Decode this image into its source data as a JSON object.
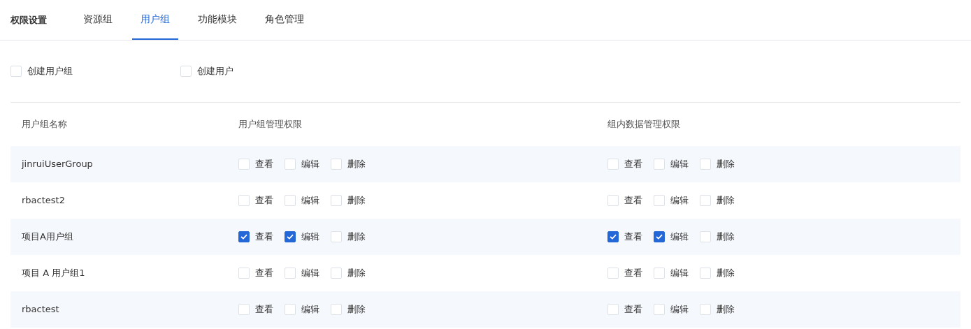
{
  "header": {
    "title": "权限设置",
    "tabs": [
      {
        "label": "资源组",
        "selected": false
      },
      {
        "label": "用户组",
        "selected": true
      },
      {
        "label": "功能模块",
        "selected": false
      },
      {
        "label": "角色管理",
        "selected": false
      }
    ]
  },
  "options": [
    {
      "label": "创建用户组",
      "checked": false
    },
    {
      "label": "创建用户",
      "checked": false
    }
  ],
  "table": {
    "columns": [
      "用户组名称",
      "用户组管理权限",
      "组内数据管理权限"
    ],
    "rows": [
      {
        "name": "jinruiUserGroup",
        "groups": [
          [
            {
              "label": "查看",
              "checked": false
            },
            {
              "label": "编辑",
              "checked": false
            },
            {
              "label": "删除",
              "checked": false
            }
          ],
          [
            {
              "label": "查看",
              "checked": false
            },
            {
              "label": "编辑",
              "checked": false
            },
            {
              "label": "删除",
              "checked": false
            }
          ]
        ]
      },
      {
        "name": "rbactest2",
        "groups": [
          [
            {
              "label": "查看",
              "checked": false
            },
            {
              "label": "编辑",
              "checked": false
            },
            {
              "label": "删除",
              "checked": false
            }
          ],
          [
            {
              "label": "查看",
              "checked": false
            },
            {
              "label": "编辑",
              "checked": false
            },
            {
              "label": "删除",
              "checked": false
            }
          ]
        ]
      },
      {
        "name": "项目A用户组",
        "groups": [
          [
            {
              "label": "查看",
              "checked": true
            },
            {
              "label": "编辑",
              "checked": true
            },
            {
              "label": "删除",
              "checked": false
            }
          ],
          [
            {
              "label": "查看",
              "checked": true
            },
            {
              "label": "编辑",
              "checked": true
            },
            {
              "label": "删除",
              "checked": false
            }
          ]
        ]
      },
      {
        "name": "项目 A 用户组1",
        "groups": [
          [
            {
              "label": "查看",
              "checked": false
            },
            {
              "label": "编辑",
              "checked": false
            },
            {
              "label": "删除",
              "checked": false
            }
          ],
          [
            {
              "label": "查看",
              "checked": false
            },
            {
              "label": "编辑",
              "checked": false
            },
            {
              "label": "删除",
              "checked": false
            }
          ]
        ]
      },
      {
        "name": "rbactest",
        "groups": [
          [
            {
              "label": "查看",
              "checked": false
            },
            {
              "label": "编辑",
              "checked": false
            },
            {
              "label": "删除",
              "checked": false
            }
          ],
          [
            {
              "label": "查看",
              "checked": false
            },
            {
              "label": "编辑",
              "checked": false
            },
            {
              "label": "删除",
              "checked": false
            }
          ]
        ]
      }
    ]
  }
}
